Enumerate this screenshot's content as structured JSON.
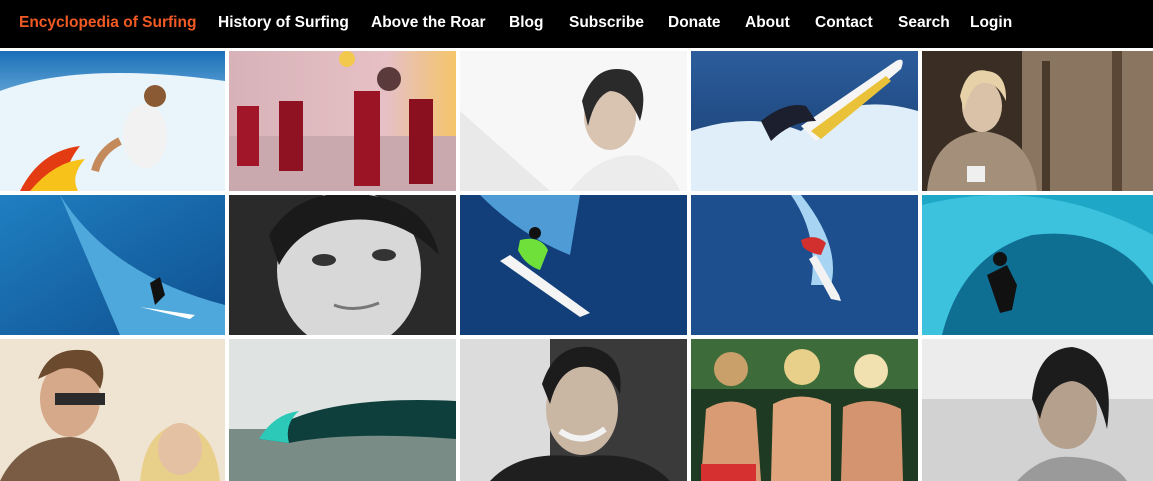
{
  "nav": {
    "brand": "Encyclopedia of Surfing",
    "items": [
      {
        "key": "history",
        "label": "History of Surfing"
      },
      {
        "key": "above-the-roar",
        "label": "Above the Roar"
      },
      {
        "key": "blog",
        "label": "Blog"
      },
      {
        "key": "subscribe",
        "label": "Subscribe"
      },
      {
        "key": "donate",
        "label": "Donate"
      },
      {
        "key": "about",
        "label": "About"
      },
      {
        "key": "contact",
        "label": "Contact"
      },
      {
        "key": "search",
        "label": "Search"
      },
      {
        "key": "login",
        "label": "Login"
      }
    ]
  },
  "colors": {
    "nav_background": "#000000",
    "brand": "#f15a24",
    "nav_text": "#ffffff"
  },
  "gallery": {
    "tiles": [
      {
        "subject": "surfer-with-flames"
      },
      {
        "subject": "surf-band"
      },
      {
        "subject": "surfer-portrait-bw"
      },
      {
        "subject": "surfer-aerial"
      },
      {
        "subject": "surfer-with-mug"
      },
      {
        "subject": "big-wave-surfer"
      },
      {
        "subject": "face-closeup-bw"
      },
      {
        "subject": "surfer-overhead-blue"
      },
      {
        "subject": "surfer-bottom-turn"
      },
      {
        "subject": "surfer-in-barrel"
      },
      {
        "subject": "couple-in-sunglasses"
      },
      {
        "subject": "barreling-wave"
      },
      {
        "subject": "smiling-surfer-bw"
      },
      {
        "subject": "three-surfers"
      },
      {
        "subject": "surfer-portrait-bw-2"
      }
    ]
  }
}
